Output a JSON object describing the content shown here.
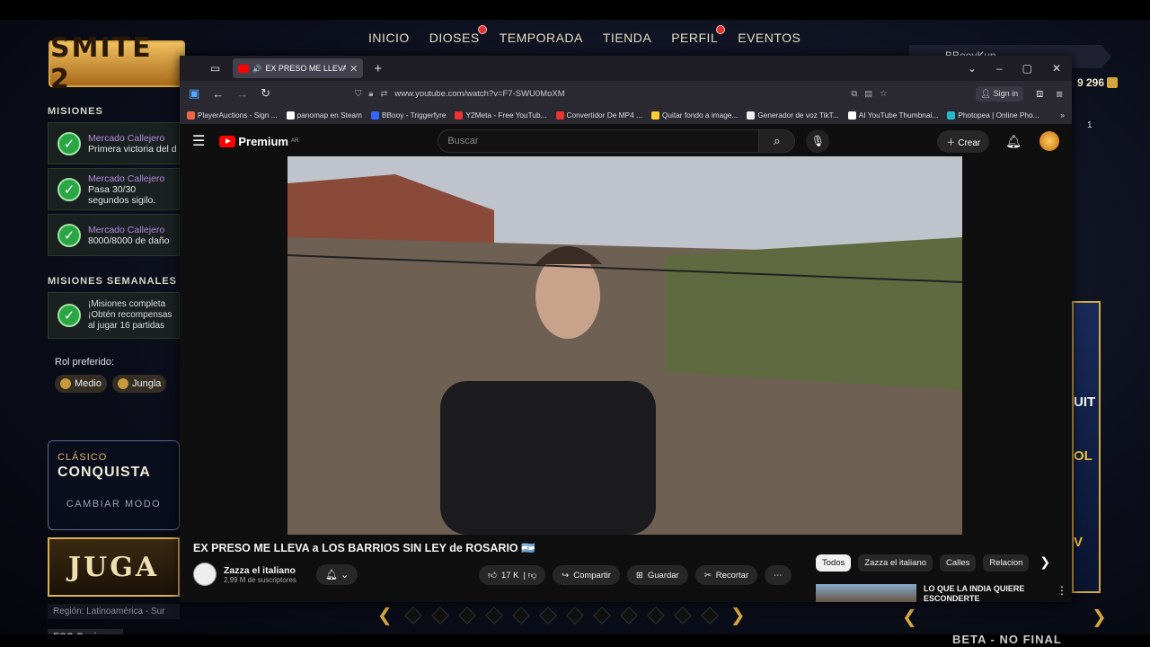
{
  "game": {
    "logo": "SMITE 2",
    "nav": [
      "INICIO",
      "DIOSES",
      "TEMPORADA",
      "TIENDA",
      "PERFIL",
      "EVENTOS"
    ],
    "username": "BBooyKun",
    "coins": "9 296",
    "count_right": "1",
    "missions_title": "MISIONES",
    "missions": [
      {
        "title": "Mercado Callejero",
        "desc": "Primera victoria del d"
      },
      {
        "title": "Mercado Callejero",
        "desc": "Pasa 30/30 segundos sigilo."
      },
      {
        "title": "Mercado Callejero",
        "desc": "8000/8000 de daño"
      }
    ],
    "weekly_title": "MISIONES SEMANALES",
    "weekly_text": "¡Misiones completa ¡Obtén recompensas al jugar 16 partidas",
    "role_label": "Rol preferido:",
    "roles": [
      "Medio",
      "Jungla"
    ],
    "mode_small": "CLÁSICO",
    "mode_big": "CONQUISTA",
    "mode_change": "CAMBIAR MODO",
    "play": "JUGA",
    "region": "Región: Latinoamérica - Sur",
    "esc": "ESC  Opciones",
    "right_card_labels": [
      "UIT",
      "OL",
      "V"
    ],
    "beta": "BETA - NO FINAL"
  },
  "browser": {
    "tab_title": "EX PRESO ME LLEVA a LOS",
    "url": "www.youtube.com/watch?v=F7-SWU0MoXM",
    "signin": "Sign in",
    "bookmarks": [
      {
        "label": "PlayerAuctions - Sign ...",
        "color": "#e64"
      },
      {
        "label": "panomap en Steam",
        "color": "#fff"
      },
      {
        "label": "BBooy - Triggerfyre",
        "color": "#36f"
      },
      {
        "label": "Y2Meta - Free YouTub...",
        "color": "#e33"
      },
      {
        "label": "Convertidor De MP4 ...",
        "color": "#e33"
      },
      {
        "label": "Quitar fondo a image...",
        "color": "#fc3"
      },
      {
        "label": "Generador de voz TikT...",
        "color": "#eee"
      },
      {
        "label": "AI YouTube Thumbnai...",
        "color": "#fff"
      },
      {
        "label": "Photopea | Online Pho...",
        "color": "#2bc"
      }
    ]
  },
  "youtube": {
    "logo": "Premium",
    "region": "AR",
    "search_placeholder": "Buscar",
    "create": "Crear",
    "video_title": "EX PRESO ME LLEVA a LOS BARRIOS SIN LEY de ROSARIO 🇦🇷",
    "channel": "Zazza el italiano",
    "subs": "2,99 M de suscriptores",
    "likes": "17 K",
    "share": "Compartir",
    "save": "Guardar",
    "clip": "Recortar",
    "chips": [
      "Todos",
      "Zazza el italiano",
      "Calles",
      "Relacion"
    ],
    "rec_title": "LO QUE LA INDIA QUIERE ESCONDERTE"
  }
}
